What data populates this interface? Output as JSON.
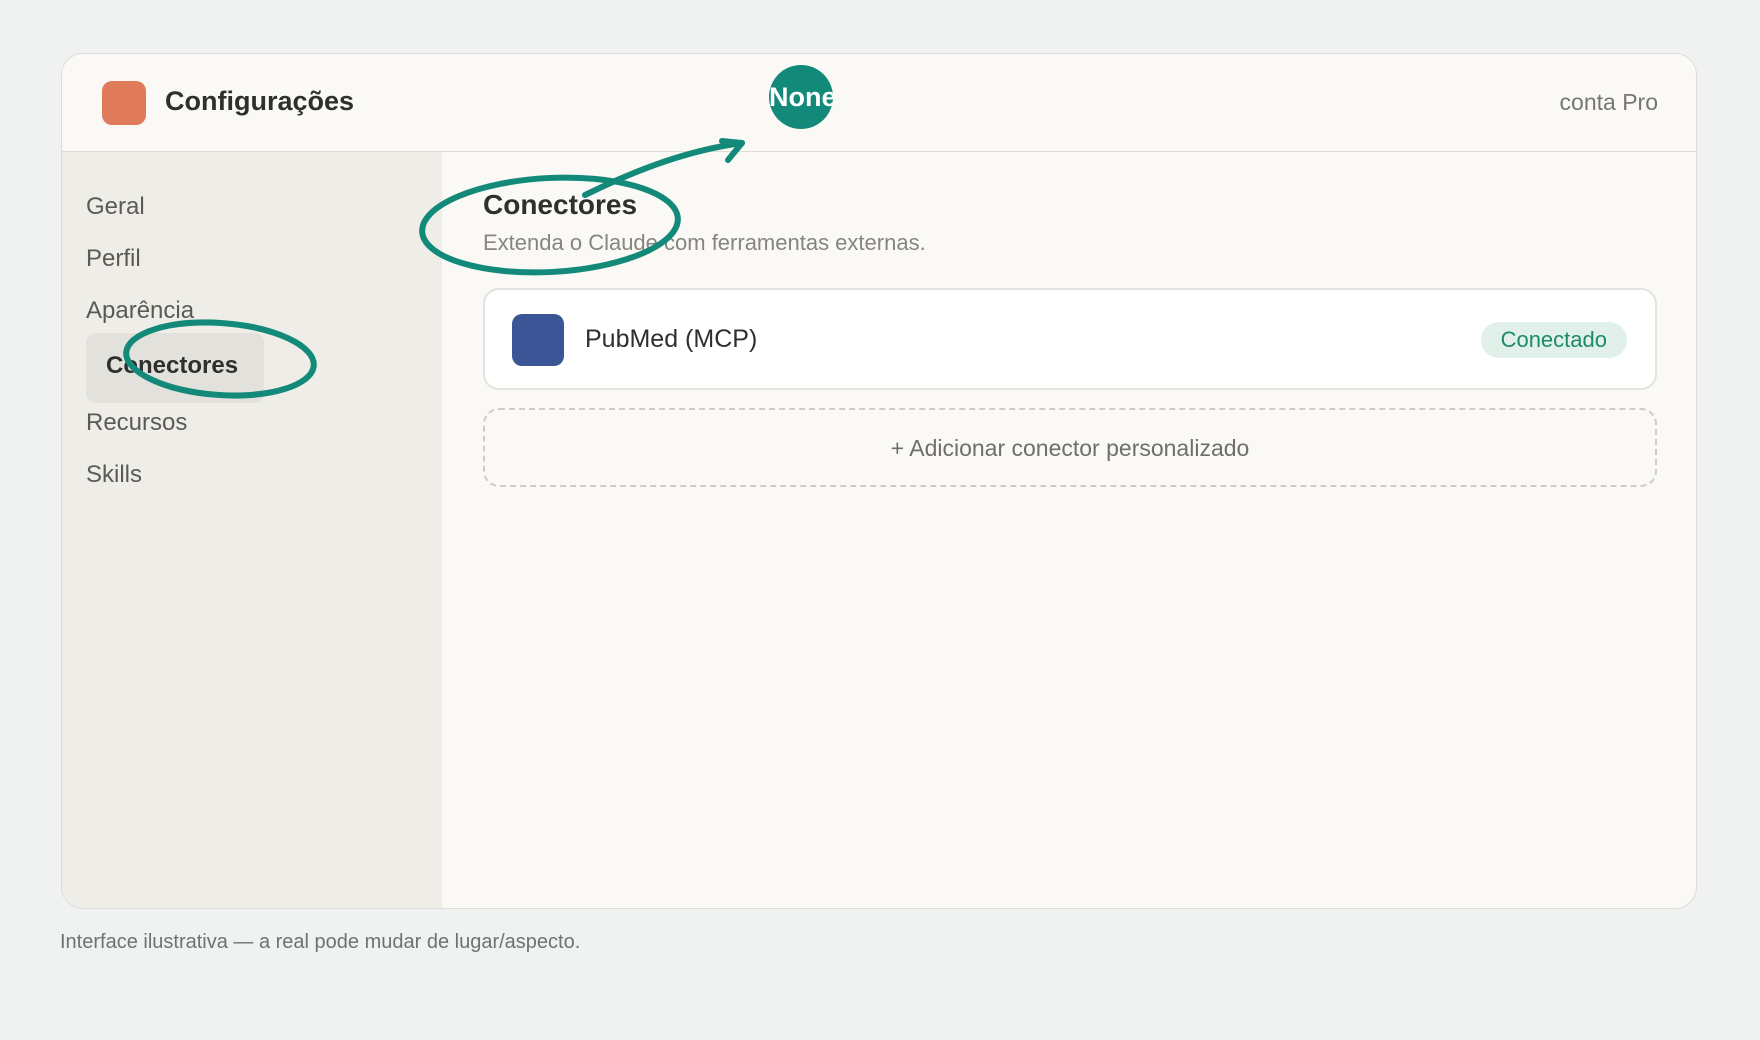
{
  "header": {
    "title": "Configurações",
    "plan": "conta Pro"
  },
  "sidebar": {
    "items": [
      {
        "label": "Geral"
      },
      {
        "label": "Perfil"
      },
      {
        "label": "Aparência"
      },
      {
        "label": "Conectores",
        "active": true
      },
      {
        "label": "Recursos"
      },
      {
        "label": "Skills"
      }
    ]
  },
  "content": {
    "title": "Conectores",
    "subtitle": "Extenda o Claude com ferramentas externas.",
    "connectors": [
      {
        "name": "PubMed (MCP)",
        "status": "Conectado",
        "icon_color": "#3c5597"
      }
    ],
    "add_label": "+ Adicionar conector personalizado"
  },
  "annotation": {
    "marker_label": "None",
    "color": "#138a79"
  },
  "footnote": "Interface ilustrativa — a real pode mudar de lugar/aspecto.",
  "colors": {
    "app_logo": "#df7a5b",
    "accent": "#138a79",
    "status_bg": "#e1f1ea",
    "status_text": "#1d8a6b"
  }
}
